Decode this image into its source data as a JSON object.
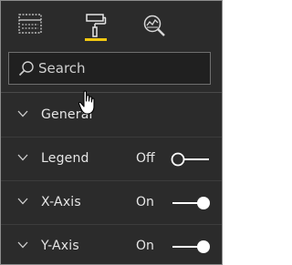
{
  "tabs": [
    {
      "icon": "fields-icon",
      "active": false
    },
    {
      "icon": "paint-roller-icon",
      "active": true
    },
    {
      "icon": "analytics-magnifier-icon",
      "active": false
    }
  ],
  "search": {
    "placeholder": "Search",
    "value": ""
  },
  "sections": [
    {
      "label": "General",
      "toggle": null
    },
    {
      "label": "Legend",
      "toggle": {
        "state_label": "Off",
        "on": false
      }
    },
    {
      "label": "X-Axis",
      "toggle": {
        "state_label": "On",
        "on": true
      }
    },
    {
      "label": "Y-Axis",
      "toggle": {
        "state_label": "On",
        "on": true
      }
    }
  ],
  "colors": {
    "background": "#2b2b2b",
    "accent": "#f2c811",
    "text": "#e6e6e6"
  }
}
